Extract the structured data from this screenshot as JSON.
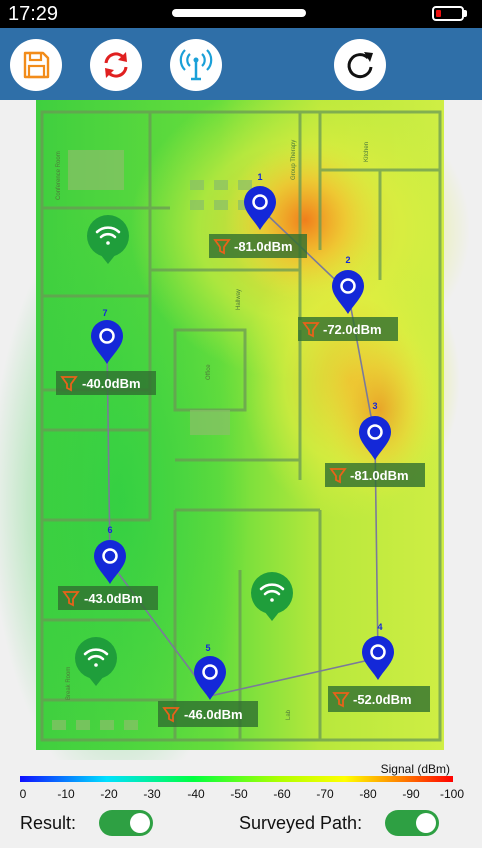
{
  "status_bar": {
    "time": "17:29"
  },
  "toolbar": {
    "buttons": [
      {
        "name": "save",
        "icon": "floppy-disk-icon"
      },
      {
        "name": "refresh",
        "icon": "sync-arrows-icon"
      },
      {
        "name": "access-point",
        "icon": "antenna-icon"
      },
      {
        "name": "redo",
        "icon": "rotate-arrow-icon"
      }
    ]
  },
  "floorplan": {
    "room_labels": [
      "Conference Room",
      "Office",
      "Hallway",
      "Break Room",
      "Group Therapy",
      "Kitchen",
      "Lab"
    ],
    "access_points": [
      {
        "id": "ap-1",
        "icon": "wifi-icon"
      },
      {
        "id": "ap-2",
        "icon": "wifi-icon"
      },
      {
        "id": "ap-3",
        "icon": "wifi-icon"
      }
    ],
    "survey_points": [
      {
        "id": "1",
        "signal": "-81.0dBm"
      },
      {
        "id": "2",
        "signal": "-72.0dBm"
      },
      {
        "id": "3",
        "signal": "-81.0dBm"
      },
      {
        "id": "4",
        "signal": "-52.0dBm"
      },
      {
        "id": "5",
        "signal": "-46.0dBm"
      },
      {
        "id": "6",
        "signal": "-43.0dBm"
      },
      {
        "id": "7",
        "signal": "-40.0dBm"
      }
    ]
  },
  "legend": {
    "title": "Signal (dBm)",
    "ticks": [
      "0",
      "-10",
      "-20",
      "-30",
      "-40",
      "-50",
      "-60",
      "-70",
      "-80",
      "-90",
      "-100"
    ],
    "colors": [
      "#1010ff",
      "#00e0ff",
      "#00ff40",
      "#b0ff00",
      "#ffff00",
      "#ff8000",
      "#ff0000"
    ]
  },
  "controls": {
    "result_label": "Result:",
    "result_on": true,
    "surveyed_path_label": "Surveyed Path:",
    "surveyed_path_on": true
  },
  "colors": {
    "toolbar": "#2f6fa8",
    "pin": "#1428d8",
    "ap": "#1f9e3b",
    "label_box": "#2f6f2f",
    "filter_icon": "#e8621a",
    "toggle": "#2ea043"
  }
}
